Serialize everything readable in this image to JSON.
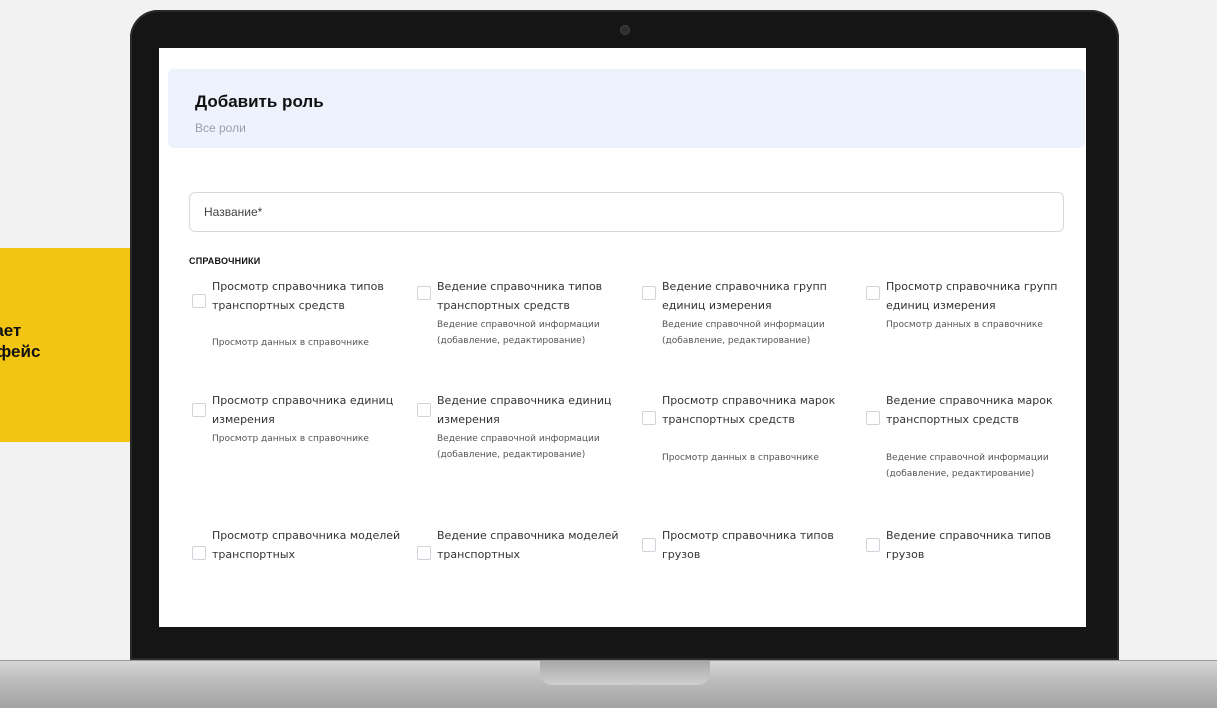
{
  "side_banner": {
    "text_line1": "тает",
    "text_line2": "рфейс"
  },
  "header": {
    "title": "Добавить роль",
    "breadcrumb": "Все роли"
  },
  "form": {
    "name_placeholder": "Название*"
  },
  "section": {
    "title": "СПРАВОЧНИКИ"
  },
  "permissions": [
    {
      "title": "Просмотр справочника типов транспортных средств",
      "description": "Просмотр данных в справочнике",
      "checked": false
    },
    {
      "title": "Ведение справочника типов транспортных средств",
      "description": "Ведение справочной информации (добавление, редактирование)",
      "checked": false
    },
    {
      "title": "Ведение справочника групп единиц измерения",
      "description": "Ведение справочной информации (добавление, редактирование)",
      "checked": false
    },
    {
      "title": "Просмотр справочника групп единиц измерения",
      "description": "Просмотр данных в справочнике",
      "checked": false
    },
    {
      "title": "Просмотр справочника единиц измерения",
      "description": "Просмотр данных в справочнике",
      "checked": false
    },
    {
      "title": "Ведение справочника единиц измерения",
      "description": "Ведение справочной информации (добавление, редактирование)",
      "checked": false
    },
    {
      "title": "Просмотр справочника марок транспортных средств",
      "description": "Просмотр данных в справочнике",
      "checked": false
    },
    {
      "title": "Ведение справочника марок транспортных средств",
      "description": "Ведение справочной информации (добавление, редактирование)",
      "checked": false
    },
    {
      "title": "Просмотр справочника моделей транспортных",
      "description": "",
      "checked": false
    },
    {
      "title": "Ведение справочника моделей транспортных",
      "description": "",
      "checked": false
    },
    {
      "title": "Просмотр справочника типов грузов",
      "description": "",
      "checked": false
    },
    {
      "title": "Ведение справочника типов грузов",
      "description": "",
      "checked": false
    }
  ]
}
